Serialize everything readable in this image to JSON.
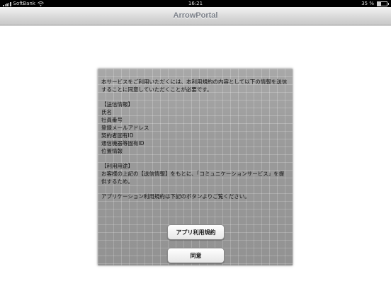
{
  "status_bar": {
    "carrier": "SoftBank",
    "time": "16:21",
    "battery_text": "35 %",
    "battery_level": 0.35
  },
  "nav": {
    "title": "ArrowPortal"
  },
  "terms": {
    "lines": [
      "本サービスをご利用いただくには、本利用規約の内容として以下の情報を送信",
      "することに同意していただくことが必要です。",
      "【送信情報】",
      "氏名",
      "社員番号",
      "登録メールアドレス",
      "契約者固有ID",
      "通信機器等固有ID",
      "位置情報",
      "【利用用途】",
      "お客様の上記の【送信情報】をもとに、「コミュニケーションサービス」を提",
      "供するため。",
      "アプリケーション利用規約は下記のボタンよりご覧ください。"
    ]
  },
  "buttons": {
    "terms_label": "アプリ利用規約",
    "agree_label": "同意"
  }
}
